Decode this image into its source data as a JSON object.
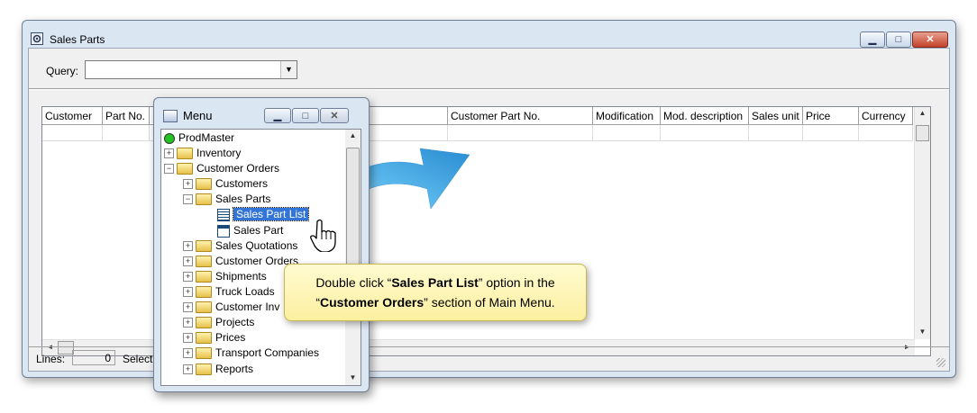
{
  "main_window": {
    "title": "Sales Parts",
    "query_label": "Query:",
    "query_value": "",
    "columns": [
      "Customer",
      "Part No.",
      "",
      "Customer Part No.",
      "Modification",
      "Mod. description",
      "Sales unit",
      "Price",
      "Currency"
    ],
    "status": {
      "lines_label": "Lines:",
      "lines_value": "0",
      "select_label": "Select"
    }
  },
  "menu_window": {
    "title": "Menu",
    "tree": [
      {
        "label": "ProdMaster",
        "level": 0,
        "icon": "root-icon"
      },
      {
        "label": "Inventory",
        "level": 1,
        "icon": "folder-icon",
        "expander": "+"
      },
      {
        "label": "Customer Orders",
        "level": 1,
        "icon": "folder-open-icon",
        "expander": "-"
      },
      {
        "label": "Customers",
        "level": 2,
        "icon": "folder-icon",
        "expander": "+"
      },
      {
        "label": "Sales Parts",
        "level": 2,
        "icon": "folder-open-icon",
        "expander": "-"
      },
      {
        "label": "Sales Part List",
        "level": 3,
        "icon": "list-icon",
        "selected": true
      },
      {
        "label": "Sales Part",
        "level": 3,
        "icon": "form-icon"
      },
      {
        "label": "Sales Quotations",
        "level": 2,
        "icon": "folder-icon",
        "expander": "+"
      },
      {
        "label": "Customer Orders",
        "level": 2,
        "icon": "folder-icon",
        "expander": "+"
      },
      {
        "label": "Shipments",
        "level": 2,
        "icon": "folder-icon",
        "expander": "+"
      },
      {
        "label": "Truck Loads",
        "level": 2,
        "icon": "folder-icon",
        "expander": "+"
      },
      {
        "label": "Customer Inv",
        "level": 2,
        "icon": "folder-icon",
        "expander": "+"
      },
      {
        "label": "Projects",
        "level": 2,
        "icon": "folder-icon",
        "expander": "+"
      },
      {
        "label": "Prices",
        "level": 2,
        "icon": "folder-icon",
        "expander": "+"
      },
      {
        "label": "Transport Companies",
        "level": 2,
        "icon": "folder-icon",
        "expander": "+"
      },
      {
        "label": "Reports",
        "level": 2,
        "icon": "folder-icon",
        "expander": "+"
      }
    ]
  },
  "callout": {
    "line1_pre": "Double click “",
    "line1_bold": "Sales Part List",
    "line1_post": "” option in the",
    "line2_pre": "“",
    "line2_bold": "Customer Orders",
    "line2_post": "” section of Main Menu."
  },
  "colors": {
    "accent_arrow": "#2f9ee0",
    "selection": "#3375d6",
    "callout_bg": "#fdf3b0"
  }
}
